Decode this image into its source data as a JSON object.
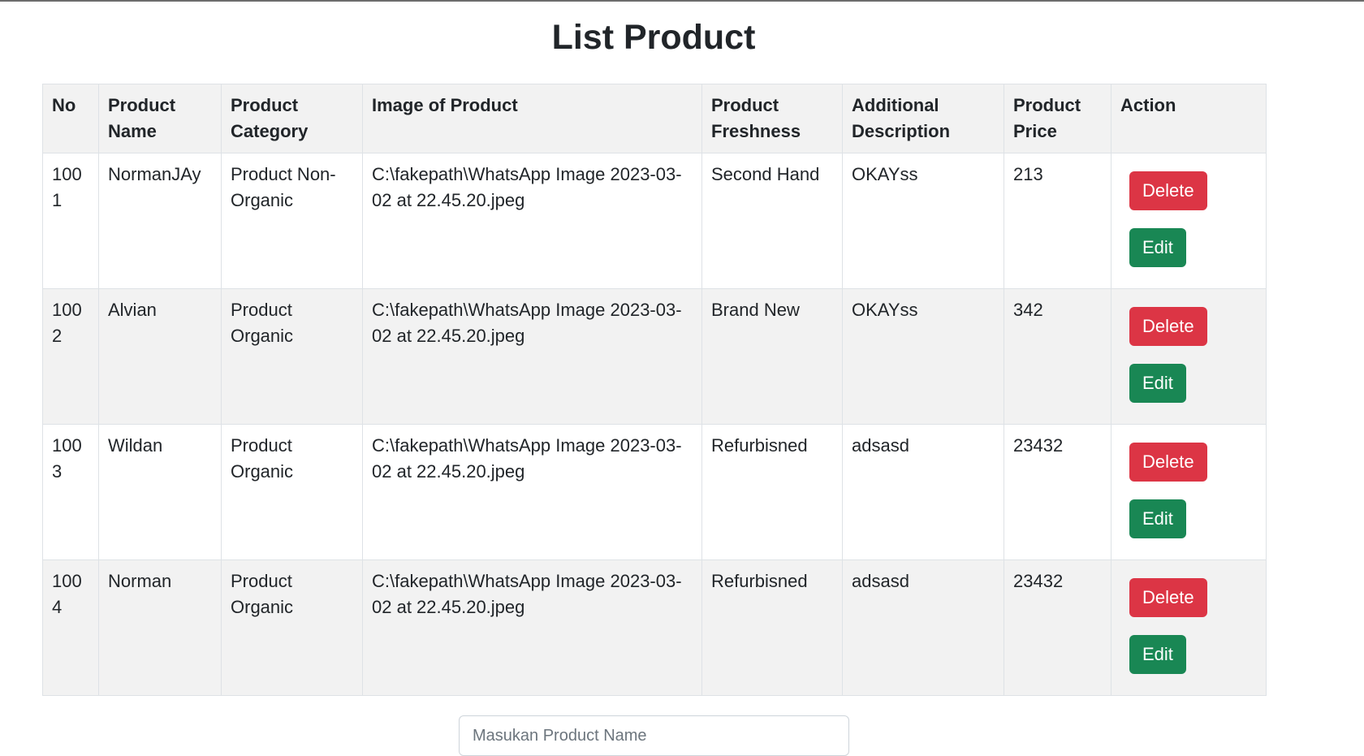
{
  "page": {
    "title": "List Product"
  },
  "table": {
    "headers": {
      "no": "No",
      "name": "Product Name",
      "category": "Product Category",
      "image": "Image of Product",
      "freshness": "Product Freshness",
      "description": "Additional Description",
      "price": "Product Price",
      "action": "Action"
    },
    "rows": [
      {
        "no": "1001",
        "name": "NormanJAy",
        "category": "Product Non-Organic",
        "image": "C:\\fakepath\\WhatsApp Image 2023-03-02 at 22.45.20.jpeg",
        "freshness": "Second Hand",
        "description": "OKAYss",
        "price": "213",
        "delete_label": "Delete",
        "edit_label": "Edit"
      },
      {
        "no": "1002",
        "name": "Alvian",
        "category": "Product Organic",
        "image": "C:\\fakepath\\WhatsApp Image 2023-03-02 at 22.45.20.jpeg",
        "freshness": "Brand New",
        "description": "OKAYss",
        "price": "342",
        "delete_label": "Delete",
        "edit_label": "Edit"
      },
      {
        "no": "1003",
        "name": "Wildan",
        "category": "Product Organic",
        "image": "C:\\fakepath\\WhatsApp Image 2023-03-02 at 22.45.20.jpeg",
        "freshness": "Refurbisned",
        "description": "adsasd",
        "price": "23432",
        "delete_label": "Delete",
        "edit_label": "Edit"
      },
      {
        "no": "1004",
        "name": "Norman",
        "category": "Product Organic",
        "image": "C:\\fakepath\\WhatsApp Image 2023-03-02 at 22.45.20.jpeg",
        "freshness": "Refurbisned",
        "description": "adsasd",
        "price": "23432",
        "delete_label": "Delete",
        "edit_label": "Edit"
      }
    ]
  },
  "form": {
    "product_name_placeholder": "Masukan Product Name",
    "product_name_value": ""
  },
  "colors": {
    "delete": "#dc3545",
    "edit": "#198754",
    "header_bg": "#f2f2f2",
    "stripe_bg": "#f2f2f2"
  }
}
